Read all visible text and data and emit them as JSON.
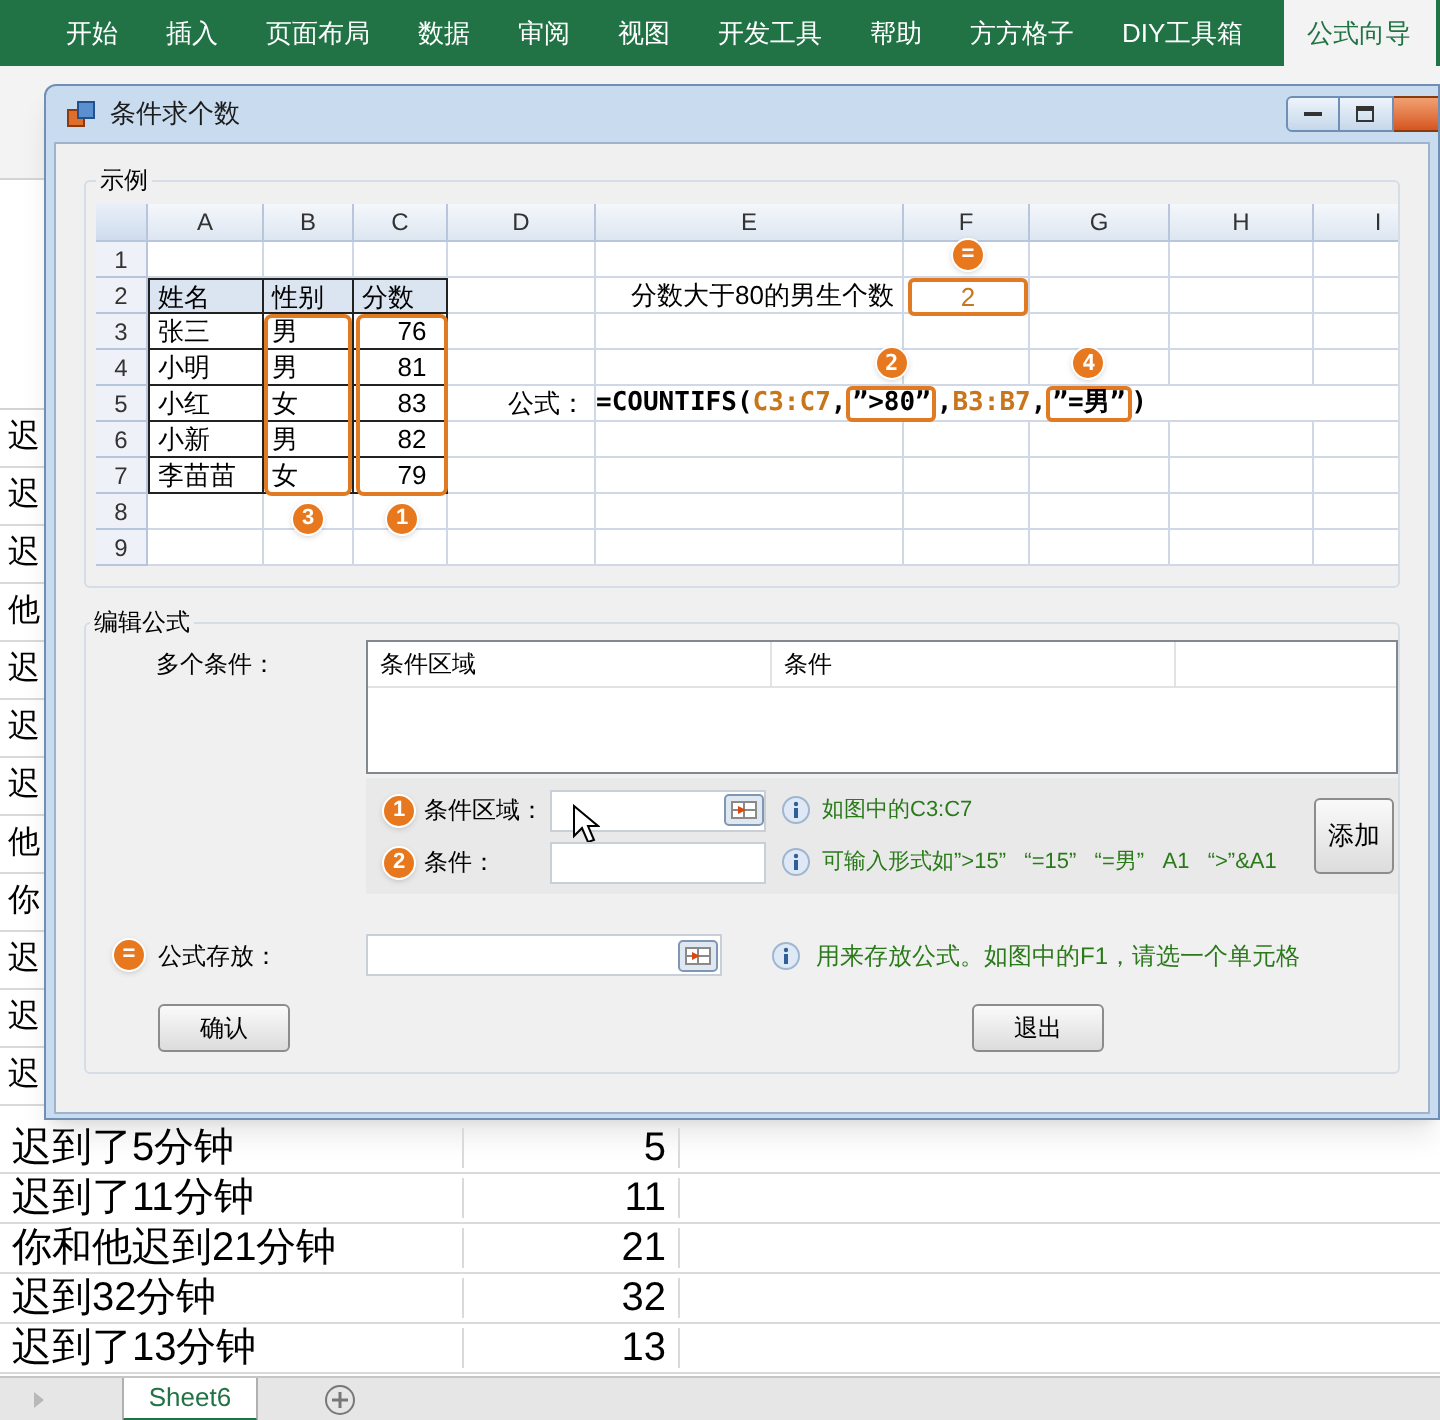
{
  "ribbon_tabs": [
    {
      "label": "开始",
      "selected": false
    },
    {
      "label": "插入",
      "selected": false
    },
    {
      "label": "页面布局",
      "selected": false
    },
    {
      "label": "数据",
      "selected": false
    },
    {
      "label": "审阅",
      "selected": false
    },
    {
      "label": "视图",
      "selected": false
    },
    {
      "label": "开发工具",
      "selected": false
    },
    {
      "label": "帮助",
      "selected": false
    },
    {
      "label": "方方格子",
      "selected": false
    },
    {
      "label": "DIY工具箱",
      "selected": false
    },
    {
      "label": "公式向导",
      "selected": true
    }
  ],
  "rows_behind_dialog": [
    "迟",
    "迟",
    "迟",
    "他",
    "迟",
    "迟",
    "迟",
    "他",
    "你",
    "迟",
    "迟",
    "迟"
  ],
  "sheet_rows": [
    {
      "text": "迟到了5分钟",
      "value": "5"
    },
    {
      "text": "迟到了11分钟",
      "value": "11"
    },
    {
      "text": "你和他迟到21分钟",
      "value": "21"
    },
    {
      "text": "迟到32分钟",
      "value": "32"
    },
    {
      "text": "迟到了13分钟",
      "value": "13"
    }
  ],
  "sheet_tabs": [
    {
      "label": "Sheet6",
      "selected": true
    }
  ],
  "dialog": {
    "title": "条件求个数",
    "example": {
      "legend": "示例",
      "columns": [
        "A",
        "B",
        "C",
        "D",
        "E",
        "F",
        "G",
        "H",
        "I"
      ],
      "rows": [
        {
          "number": "1",
          "header": false
        },
        {
          "number": "2",
          "header": true,
          "A": "姓名",
          "B": "性别",
          "C": "分数",
          "E": "分数大于80的男生个数"
        },
        {
          "number": "3",
          "header": false,
          "A": "张三",
          "B": "男",
          "C": "76"
        },
        {
          "number": "4",
          "header": false,
          "A": "小明",
          "B": "男",
          "C": "81"
        },
        {
          "number": "5",
          "header": false,
          "A": "小红",
          "B": "女",
          "C": "83",
          "D": "公式：",
          "formula": [
            {
              "kind": "function",
              "text": "=COUNTIFS("
            },
            {
              "kind": "reference",
              "text": "C3:C7"
            },
            {
              "kind": "function",
              "text": ","
            },
            {
              "kind": "criteria",
              "text": "”>80”",
              "badge": "2"
            },
            {
              "kind": "function",
              "text": ","
            },
            {
              "kind": "reference",
              "text": "B3:B7"
            },
            {
              "kind": "function",
              "text": ","
            },
            {
              "kind": "criteria",
              "text": "”=男”",
              "badge": "4"
            },
            {
              "kind": "function",
              "text": ")"
            }
          ]
        },
        {
          "number": "6",
          "header": false,
          "A": "小新",
          "B": "男",
          "C": "82"
        },
        {
          "number": "7",
          "header": false,
          "A": "李苗苗",
          "B": "女",
          "C": "79"
        },
        {
          "number": "8",
          "header": false
        },
        {
          "number": "9",
          "header": false
        }
      ],
      "result": {
        "badge": "=",
        "value": "2"
      },
      "range_marks": [
        {
          "badge": "3"
        },
        {
          "badge": "1"
        }
      ]
    },
    "editor": {
      "legend": "编辑公式",
      "conditions_label": "多个条件：",
      "list_columns": [
        "条件区域",
        "条件"
      ],
      "fields": [
        {
          "badge": "1",
          "label": "条件区域：",
          "hint": "如图中的C3:C7",
          "picker": true,
          "hovered": true
        },
        {
          "badge": "2",
          "label": "条件：",
          "hint": "可输入形式如”>15”   “=15”   “=男”   A1   “>”&A1",
          "picker": false,
          "hovered": false
        }
      ],
      "add_button": "添加",
      "storage": {
        "badge": "=",
        "label": "公式存放：",
        "hint": "用来存放公式。如图中的F1，请选一个单元格"
      },
      "buttons": [
        "确认",
        "退出"
      ]
    }
  }
}
